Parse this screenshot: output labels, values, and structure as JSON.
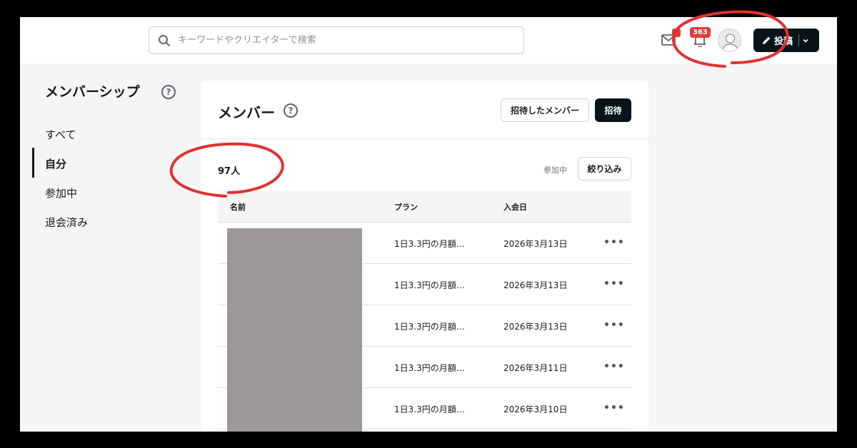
{
  "header": {
    "search_placeholder": "キーワードやクリエイターで検索",
    "notifications_count": "363",
    "post_label": "投稿"
  },
  "sidebar": {
    "title": "メンバーシップ",
    "help": "?",
    "items": [
      {
        "label": "すべて",
        "active": false
      },
      {
        "label": "自分",
        "active": true
      },
      {
        "label": "参加中",
        "active": false
      },
      {
        "label": "退会済み",
        "active": false
      }
    ]
  },
  "main": {
    "title": "メンバー",
    "help": "?",
    "invited_members_label": "招待したメンバー",
    "invite_label": "招待",
    "member_count": "97人",
    "filter_status": "参加中",
    "filter_label": "絞り込み",
    "table": {
      "headers": [
        "名前",
        "プラン",
        "入会日"
      ],
      "rows": [
        {
          "plan": "1日3.3円の月額…",
          "joined": "2026年3月13日",
          "more": "•••"
        },
        {
          "plan": "1日3.3円の月額…",
          "joined": "2026年3月13日",
          "more": "•••"
        },
        {
          "plan": "1日3.3円の月額…",
          "joined": "2026年3月13日",
          "more": "•••"
        },
        {
          "plan": "1日3.3円の月額…",
          "joined": "2026年3月11日",
          "more": "•••"
        },
        {
          "plan": "1日3.3円の月額…",
          "joined": "2026年3月10日",
          "more": "•••"
        }
      ]
    }
  },
  "colors": {
    "accent_dark": "#08131a",
    "badge_red": "#e33b3b",
    "annotation_red": "#e0322f",
    "redaction_gray": "#9c9898"
  },
  "icons": [
    "search-icon",
    "mail-icon",
    "bell-icon",
    "avatar",
    "pencil-icon",
    "chevron-down-icon",
    "help-icon",
    "more-icon"
  ]
}
